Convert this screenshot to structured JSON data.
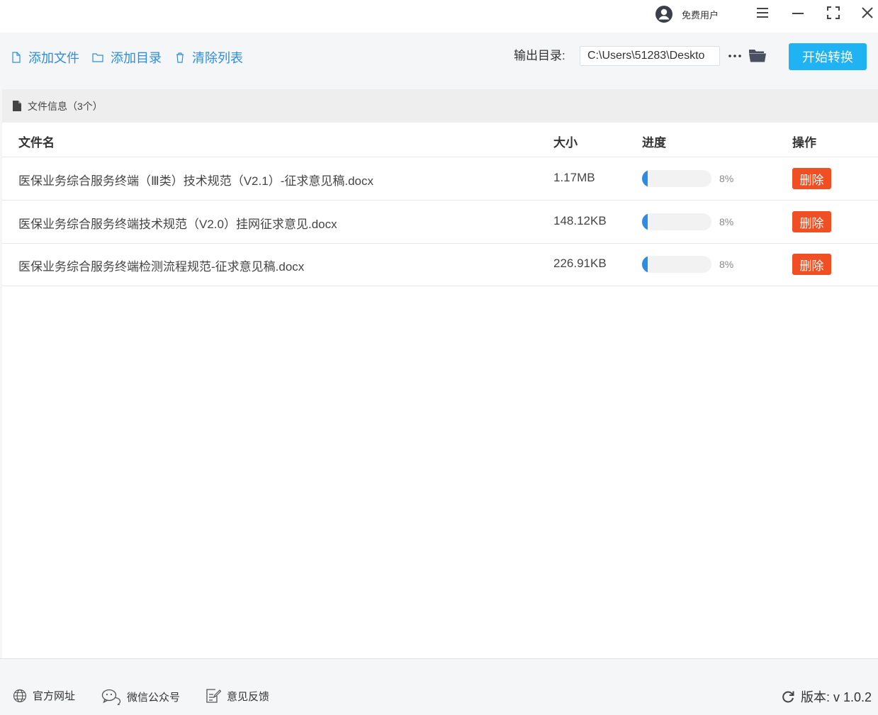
{
  "titlebar": {
    "user_label": "免费用户",
    "icons": [
      "user-avatar-icon",
      "menu-icon",
      "minimize-icon",
      "maximize-icon",
      "close-icon"
    ]
  },
  "toolbar": {
    "add_file": "添加文件",
    "add_dir": "添加目录",
    "clear_list": "清除列表",
    "output_label": "输出目录:",
    "output_path": "C:\\Users\\51283\\Deskto",
    "more_label": "···",
    "start_label": "开始转换",
    "accent": "#2d8de0",
    "start_color": "#1fb3f4"
  },
  "file_info": {
    "label": "文件信息（3个）"
  },
  "table": {
    "headers": {
      "name": "文件名",
      "size": "大小",
      "progress": "进度",
      "action": "操作"
    },
    "rows": [
      {
        "name": "医保业务综合服务终端（Ⅲ类）技术规范（V2.1）-征求意见稿.docx",
        "size": "1.17MB",
        "progress": 8,
        "progress_label": "8%",
        "action": "删除"
      },
      {
        "name": "医保业务综合服务终端技术规范（V2.0）挂网征求意见.docx",
        "size": "148.12KB",
        "progress": 8,
        "progress_label": "8%",
        "action": "删除"
      },
      {
        "name": "医保业务综合服务终端检测流程规范-征求意见稿.docx",
        "size": "226.91KB",
        "progress": 8,
        "progress_label": "8%",
        "action": "删除"
      }
    ],
    "delete_color": "#f04e23"
  },
  "footer": {
    "website": "官方网址",
    "wechat": "微信公众号",
    "feedback": "意见反馈",
    "version": "版本:  v 1.0.2"
  }
}
